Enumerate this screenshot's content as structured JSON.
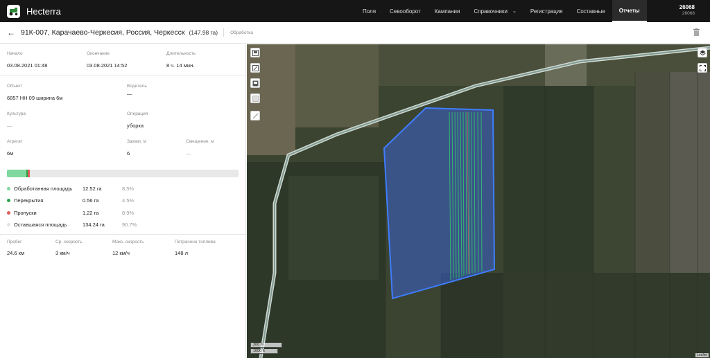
{
  "app": {
    "name": "Hecterra"
  },
  "nav": [
    {
      "label": "Поля"
    },
    {
      "label": "Севооборот"
    },
    {
      "label": "Кампании"
    },
    {
      "label": "Справочники"
    },
    {
      "label": "Регистрация"
    },
    {
      "label": "Составные"
    },
    {
      "label": "Отчеты"
    }
  ],
  "nav_active": "Отчеты",
  "user": {
    "name": "26068",
    "id": "26068"
  },
  "header": {
    "title": "91К-007, Карачаево-Черкесия, Россия, Черкесск",
    "area": "(147.98 га)",
    "operation_type": "Обработка"
  },
  "details": {
    "start_label": "Начало",
    "start_value": "03.08.2021 01:48",
    "end_label": "Окончание",
    "end_value": "03.08.2021 14:52",
    "duration_label": "Длительность",
    "duration_value": "8 ч. 14 мин.",
    "object_label": "Объект",
    "object_value": "6857 НН 09 ширина 6м",
    "driver_label": "Водитель",
    "driver_value": "—",
    "crop_label": "Культура",
    "crop_value": "—",
    "operation_label": "Операция",
    "operation_value": "уборка",
    "implement_label": "Агрегат",
    "implement_value": "6м",
    "width_label": "Захват, м",
    "width_value": "6",
    "offset_label": "Смещение, м",
    "offset_value": "—"
  },
  "coverage": {
    "bar": [
      {
        "name": "processed",
        "fraction": 0.085,
        "color": "#7fd9a0"
      },
      {
        "name": "overlaps",
        "fraction": 0.005,
        "color": "#2aa34a"
      },
      {
        "name": "gaps",
        "fraction": 0.009,
        "color": "#e25c5c"
      }
    ],
    "rows": [
      {
        "label": "Обработанная площадь",
        "value": "12.52 га",
        "percent": "8.5%",
        "color": "#7fd9a0"
      },
      {
        "label": "Перекрытия",
        "value": "0.56 га",
        "percent": "4.5%",
        "color": "#2aa34a"
      },
      {
        "label": "Пропуски",
        "value": "1.22 га",
        "percent": "8.9%",
        "color": "#e25c5c"
      },
      {
        "label": "Оставшаяся площадь",
        "value": "134.24 га",
        "percent": "90.7%",
        "color": "#e3e3e3"
      }
    ]
  },
  "stats": {
    "mileage_label": "Пробег",
    "mileage_value": "24.6 км",
    "avg_speed_label": "Ср. скорость",
    "avg_speed_value": "3 км/ч",
    "max_speed_label": "Макс. скорость",
    "max_speed_value": "12 км/ч",
    "fuel_label": "Потрачено топлива",
    "fuel_value": "148 л"
  },
  "map": {
    "scale_m": "200 m",
    "scale_ft": "1000 ft",
    "attribution": "Leaflet"
  }
}
